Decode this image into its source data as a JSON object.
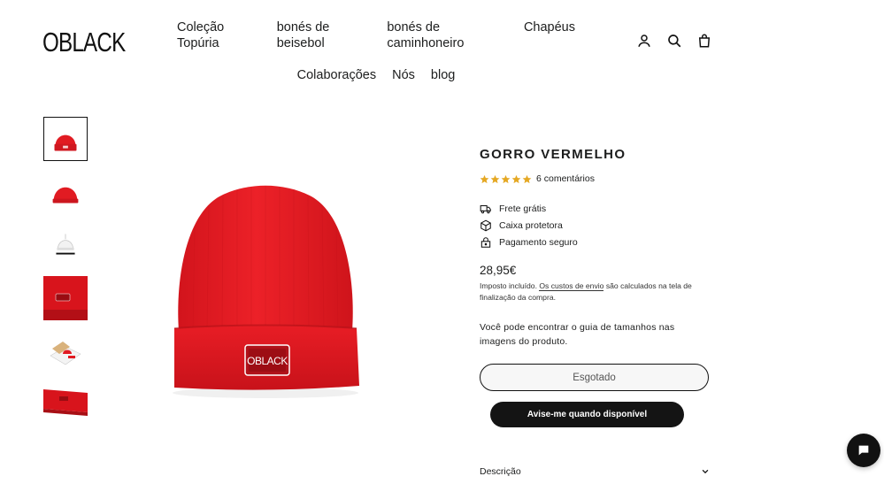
{
  "header": {
    "logo": "OBLACK",
    "nav_row1": [
      "Coleção Topúria",
      "bonés de beisebol",
      "bonés de caminhoneiro",
      "Chapéus"
    ],
    "nav_row2": [
      "Colaborações",
      "Nós",
      "blog"
    ],
    "icons": [
      "account-icon",
      "search-icon",
      "cart-icon"
    ]
  },
  "gallery": {
    "thumbnail_count": 6,
    "active_index": 0
  },
  "product": {
    "title": "GORRO VERMELHO",
    "rating": 5,
    "reviews": "6 comentários",
    "features": [
      {
        "icon": "truck-icon",
        "label": "Frete grátis"
      },
      {
        "icon": "box-icon",
        "label": "Caixa protetora"
      },
      {
        "icon": "lock-icon",
        "label": "Pagamento seguro"
      }
    ],
    "price": "28,95€",
    "tax_prefix": "Imposto incluído.",
    "tax_link": "Os custos de envio",
    "tax_suffix": "são calculados na tela de finalização da compra.",
    "size_note": "Você pode encontrar o guia de tamanhos nas imagens do produto.",
    "soldout_button": "Esgotado",
    "notify_button": "Avise-me quando disponível",
    "description_label": "Descrição",
    "patch_text": "OBLACK"
  },
  "colors": {
    "accent_red": "#e11b22",
    "star": "#e5a823",
    "dark": "#141414"
  }
}
